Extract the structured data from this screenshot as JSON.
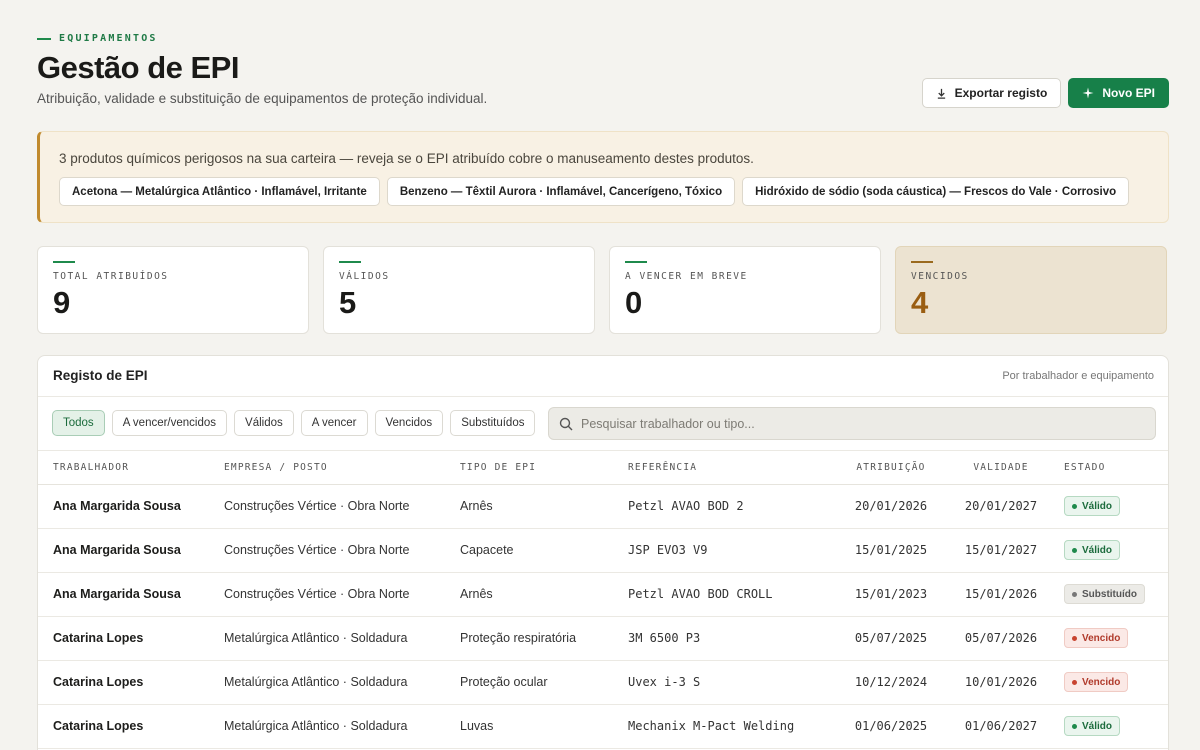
{
  "header": {
    "eyebrow": "EQUIPAMENTOS",
    "title": "Gestão de EPI",
    "subtitle": "Atribuição, validade e substituição de equipamentos de proteção individual.",
    "export_label": "Exportar registo",
    "new_label": "Novo EPI"
  },
  "alert": {
    "text": "3 produtos químicos perigosos na sua carteira — reveja se o EPI atribuído cobre o manuseamento destes produtos.",
    "chips": [
      "Acetona — Metalúrgica Atlântico · Inflamável, Irritante",
      "Benzeno — Têxtil Aurora · Inflamável, Cancerígeno, Tóxico",
      "Hidróxido de sódio (soda cáustica) — Frescos do Vale · Corrosivo"
    ]
  },
  "stats": [
    {
      "label": "TOTAL ATRIBUÍDOS",
      "value": "9"
    },
    {
      "label": "VÁLIDOS",
      "value": "5"
    },
    {
      "label": "A VENCER EM BREVE",
      "value": "0"
    },
    {
      "label": "VENCIDOS",
      "value": "4"
    }
  ],
  "panel": {
    "title": "Registo de EPI",
    "subtitle": "Por trabalhador e equipamento",
    "filters": [
      "Todos",
      "A vencer/vencidos",
      "Válidos",
      "A vencer",
      "Vencidos",
      "Substituídos"
    ],
    "search_placeholder": "Pesquisar trabalhador ou tipo..."
  },
  "table": {
    "columns": [
      "TRABALHADOR",
      "EMPRESA / POSTO",
      "TIPO DE EPI",
      "REFERÊNCIA",
      "ATRIBUIÇÃO",
      "VALIDADE",
      "ESTADO"
    ],
    "rows": [
      {
        "worker": "Ana Margarida Sousa",
        "company": "Construções Vértice · Obra Norte",
        "type": "Arnês",
        "ref": "Petzl AVAO BOD 2",
        "assigned": "20/01/2026",
        "valid": "20/01/2027",
        "status": "Válido",
        "kind": "valid"
      },
      {
        "worker": "Ana Margarida Sousa",
        "company": "Construções Vértice · Obra Norte",
        "type": "Capacete",
        "ref": "JSP EVO3 V9",
        "assigned": "15/01/2025",
        "valid": "15/01/2027",
        "status": "Válido",
        "kind": "valid"
      },
      {
        "worker": "Ana Margarida Sousa",
        "company": "Construções Vértice · Obra Norte",
        "type": "Arnês",
        "ref": "Petzl AVAO BOD CROLL",
        "assigned": "15/01/2023",
        "valid": "15/01/2026",
        "status": "Substituído",
        "kind": "replaced"
      },
      {
        "worker": "Catarina Lopes",
        "company": "Metalúrgica Atlântico · Soldadura",
        "type": "Proteção respiratória",
        "ref": "3M 6500 P3",
        "assigned": "05/07/2025",
        "valid": "05/07/2026",
        "status": "Vencido",
        "kind": "expired"
      },
      {
        "worker": "Catarina Lopes",
        "company": "Metalúrgica Atlântico · Soldadura",
        "type": "Proteção ocular",
        "ref": "Uvex i-3 S",
        "assigned": "10/12/2024",
        "valid": "10/01/2026",
        "status": "Vencido",
        "kind": "expired"
      },
      {
        "worker": "Catarina Lopes",
        "company": "Metalúrgica Atlântico · Soldadura",
        "type": "Luvas",
        "ref": "Mechanix M-Pact Welding",
        "assigned": "01/06/2025",
        "valid": "01/06/2027",
        "status": "Válido",
        "kind": "valid"
      }
    ]
  },
  "icons": {
    "export": "download-icon",
    "new": "sparkle-icon",
    "search": "search-icon"
  },
  "colors": {
    "accent": "#178049",
    "warning": "#c08a2e",
    "expired": "#c8432f"
  }
}
